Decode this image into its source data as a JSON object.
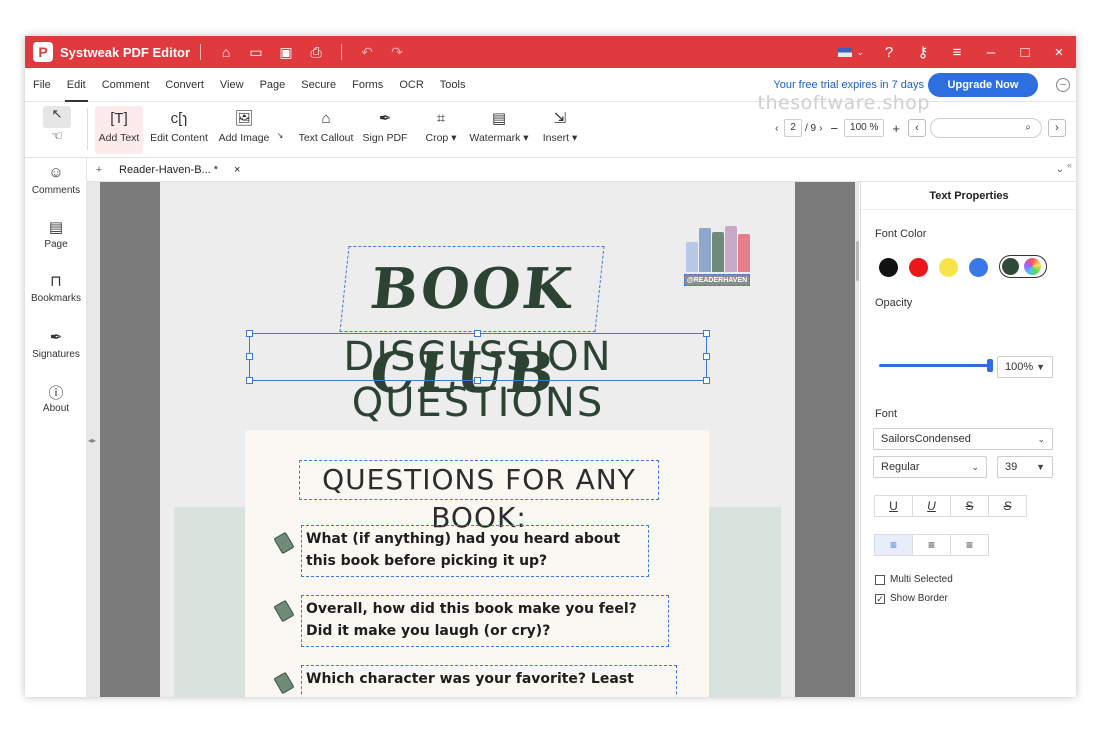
{
  "app": {
    "title": "Systweak PDF Editor",
    "logo_letter": "P"
  },
  "menu": [
    "File",
    "Edit",
    "Comment",
    "Convert",
    "View",
    "Page",
    "Secure",
    "Forms",
    "OCR",
    "Tools"
  ],
  "trial_text": "Your free trial expires in 7 days",
  "upgrade_label": "Upgrade Now",
  "watermark": "thesoftware.shop",
  "toolbar": {
    "add_text": "Add Text",
    "edit_content": "Edit Content",
    "add_image": "Add Image",
    "text_callout": "Text Callout",
    "sign_pdf": "Sign PDF",
    "crop": "Crop",
    "watermark": "Watermark",
    "insert": "Insert"
  },
  "pager": {
    "current_page": "2",
    "total": "/ 9",
    "zoom": "100 %"
  },
  "tab": {
    "name": "Reader-Haven-B...  *",
    "close": "×"
  },
  "sidebar": [
    "Comments",
    "Page",
    "Bookmarks",
    "Signatures",
    "About"
  ],
  "document": {
    "title1": "BOOK CLUB",
    "title2": "DISCUSSION QUESTIONS",
    "logo_badge": "@READERHAVEN",
    "heading": "QUESTIONS FOR ANY BOOK:",
    "questions": [
      "What (if anything) had you heard about this book before picking it up?",
      "Overall, how did this book make you feel? Did it make you laugh (or cry)?",
      "Which character was your favorite? Least"
    ]
  },
  "panel": {
    "title": "Text Properties",
    "font_color_label": "Font Color",
    "swatch_colors": [
      "#111111",
      "#e8181c",
      "#f7e44b",
      "#3b78e7",
      "#2f4a36"
    ],
    "opacity_label": "Opacity",
    "opacity_value": "100%",
    "opacity_fraction": 1.0,
    "font_label": "Font",
    "font_name": "SailorsCondensed",
    "font_style": "Regular",
    "font_size": "39",
    "multi_selected": "Multi Selected",
    "show_border": "Show Border"
  }
}
